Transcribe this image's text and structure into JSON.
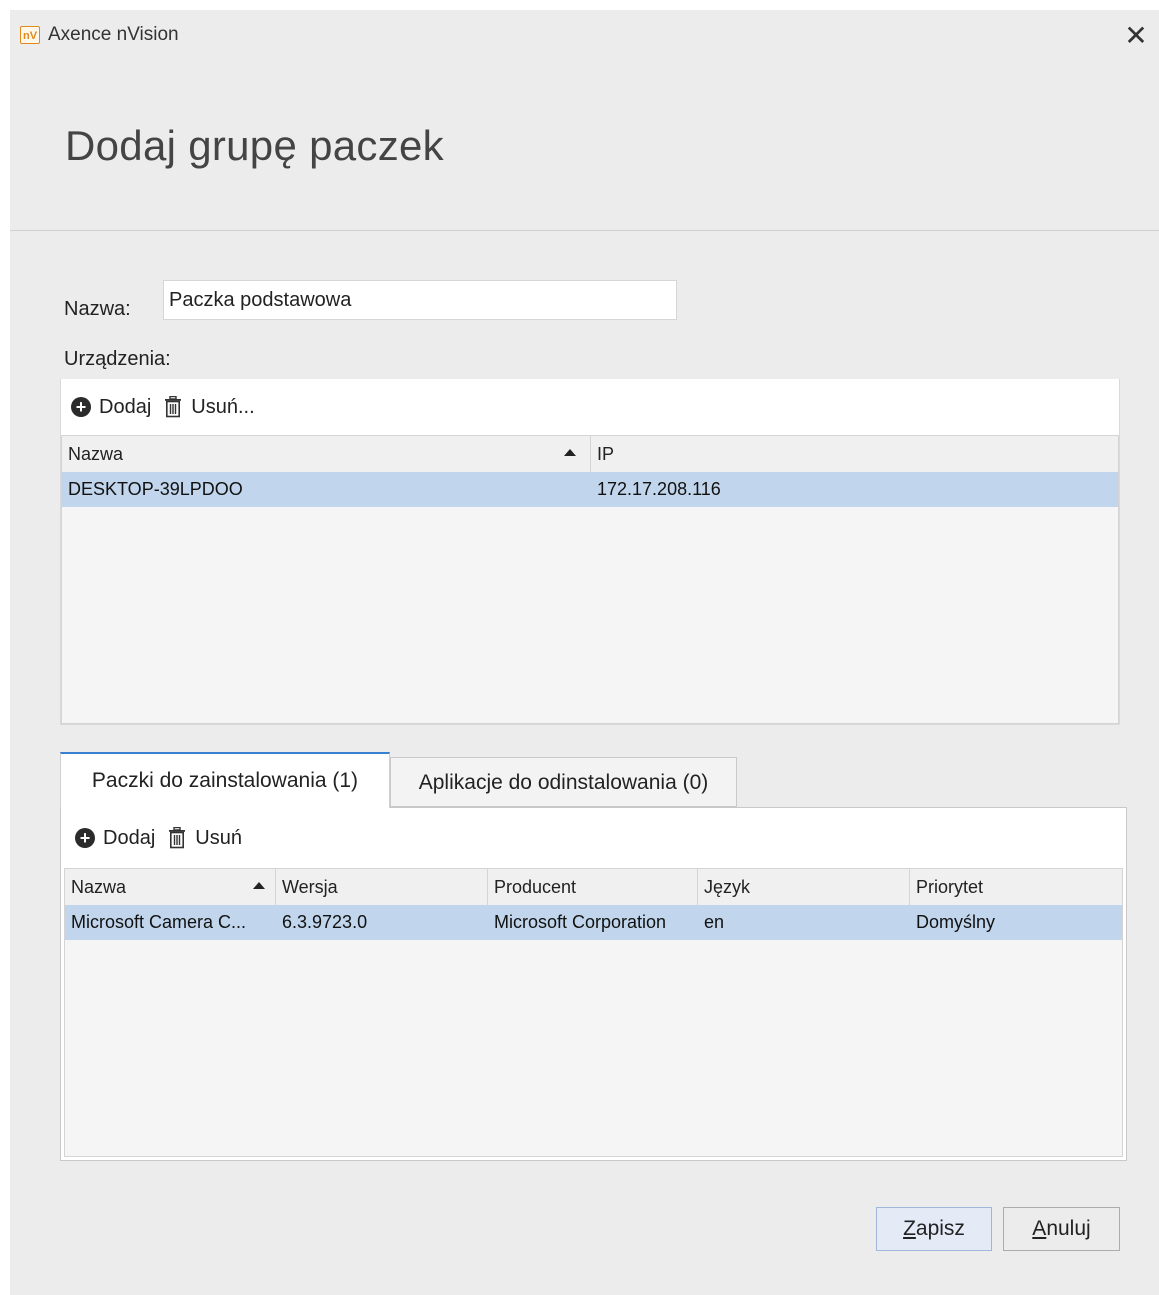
{
  "window": {
    "logo_text": "nV",
    "title": "Axence nVision"
  },
  "page_title": "Dodaj grupę paczek",
  "form": {
    "name_label": "Nazwa:",
    "name_value": "Paczka podstawowa",
    "devices_label": "Urządzenia:"
  },
  "devices": {
    "toolbar": {
      "add_label": "Dodaj",
      "remove_label": "Usuń..."
    },
    "columns": [
      "Nazwa",
      "IP"
    ],
    "sort_column": "Nazwa",
    "rows": [
      {
        "name": "DESKTOP-39LPDOO",
        "ip": "172.17.208.116",
        "selected": true
      }
    ]
  },
  "tabs": [
    {
      "label": "Paczki do zainstalowania (1)",
      "active": true
    },
    {
      "label": "Aplikacje do odinstalowania (0)",
      "active": false
    }
  ],
  "packages": {
    "toolbar": {
      "add_label": "Dodaj",
      "remove_label": "Usuń"
    },
    "columns": [
      "Nazwa",
      "Wersja",
      "Producent",
      "Język",
      "Priorytet"
    ],
    "sort_column": "Nazwa",
    "rows": [
      {
        "name": "Microsoft Camera C...",
        "version": "6.3.9723.0",
        "producer": "Microsoft Corporation",
        "language": "en",
        "priority": "Domyślny",
        "selected": true
      }
    ]
  },
  "buttons": {
    "save": {
      "mnemonic": "Z",
      "rest": "apisz"
    },
    "cancel": {
      "mnemonic": "A",
      "rest": "nuluj"
    }
  },
  "colors": {
    "selection": "#c1d5ec",
    "active_tab_accent": "#3a80d0",
    "logo": "#e08a1e"
  }
}
